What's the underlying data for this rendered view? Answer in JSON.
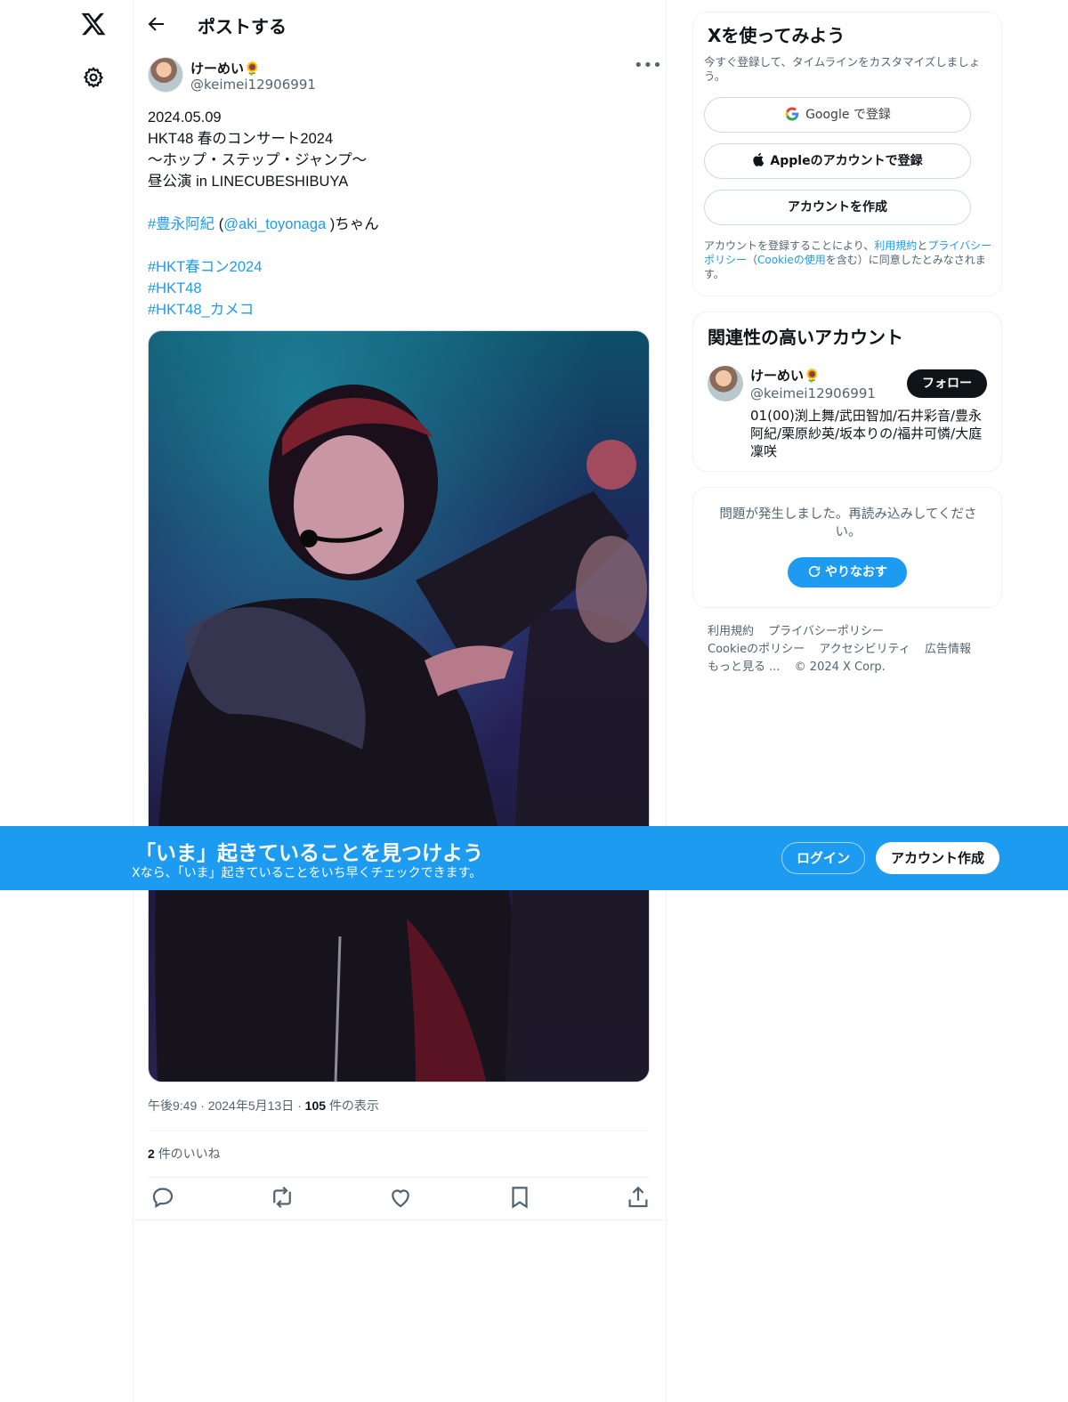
{
  "rail": {
    "logo_icon": "x-logo-icon",
    "settings_icon": "gear-icon"
  },
  "header": {
    "title": "ポストする",
    "back_icon": "arrow-left-icon"
  },
  "post": {
    "author_name": "けーめい🌻",
    "author_handle": "@keimei12906991",
    "text_lines": [
      "2024.05.09",
      "HKT48 春のコンサート2024",
      "〜ホップ・ステップ・ジャンプ〜",
      "昼公演 in LINECUBESHIBUYA"
    ],
    "hashtag_member": "#豊永阿紀",
    "mention_open": " (",
    "mention": "@aki_toyonaga",
    "mention_close": " )ちゃん",
    "hashtags": [
      "#HKT春コン2024",
      "#HKT48",
      "#HKT48_カメコ"
    ],
    "time": "午後9:49",
    "date": "2024年5月13日",
    "views_count": "105",
    "views_label": "件の表示",
    "likes_count": "2",
    "likes_label": "件のいいね",
    "separator": "·"
  },
  "actions": [
    "reply-icon",
    "retweet-icon",
    "like-icon",
    "bookmark-icon",
    "share-icon"
  ],
  "signup_card": {
    "title": "Xを使ってみよう",
    "subtitle": "今すぐ登録して、タイムラインをカスタマイズしましょう。",
    "google_label": "Google で登録",
    "apple_label": "Appleのアカウントで登録",
    "create_label": "アカウントを作成",
    "legal_pre": "アカウントを登録することにより、",
    "legal_terms": "利用規約",
    "legal_and": "と",
    "legal_privacy": "プライバシーポリシー",
    "legal_paren_open": "（",
    "legal_cookie": "Cookieの使用",
    "legal_post": "を含む）に同意したとみなされます。"
  },
  "related": {
    "title": "関連性の高いアカウント",
    "name": "けーめい🌻",
    "handle": "@keimei12906991",
    "follow_label": "フォロー",
    "bio": "01(00)渕上舞/武田智加/石井彩音/豊永阿紀/栗原紗英/坂本りの/福井可憐/大庭凜咲"
  },
  "error_card": {
    "message": "問題が発生しました。再読み込みしてください。",
    "retry_label": "やりなおす"
  },
  "footer": {
    "links": [
      "利用規約",
      "プライバシーポリシー",
      "Cookieのポリシー",
      "アクセシビリティ",
      "広告情報",
      "もっと見る ...",
      "© 2024 X Corp."
    ]
  },
  "banner": {
    "title": "「いま」起きていることを見つけよう",
    "subtitle": "Xなら、「いま」起きていることをいち早くチェックできます。",
    "login_label": "ログイン",
    "signup_label": "アカウント作成"
  },
  "colors": {
    "accent": "#1d9bf0",
    "text": "#0f1419",
    "muted": "#536471",
    "border": "#eff3f4"
  }
}
